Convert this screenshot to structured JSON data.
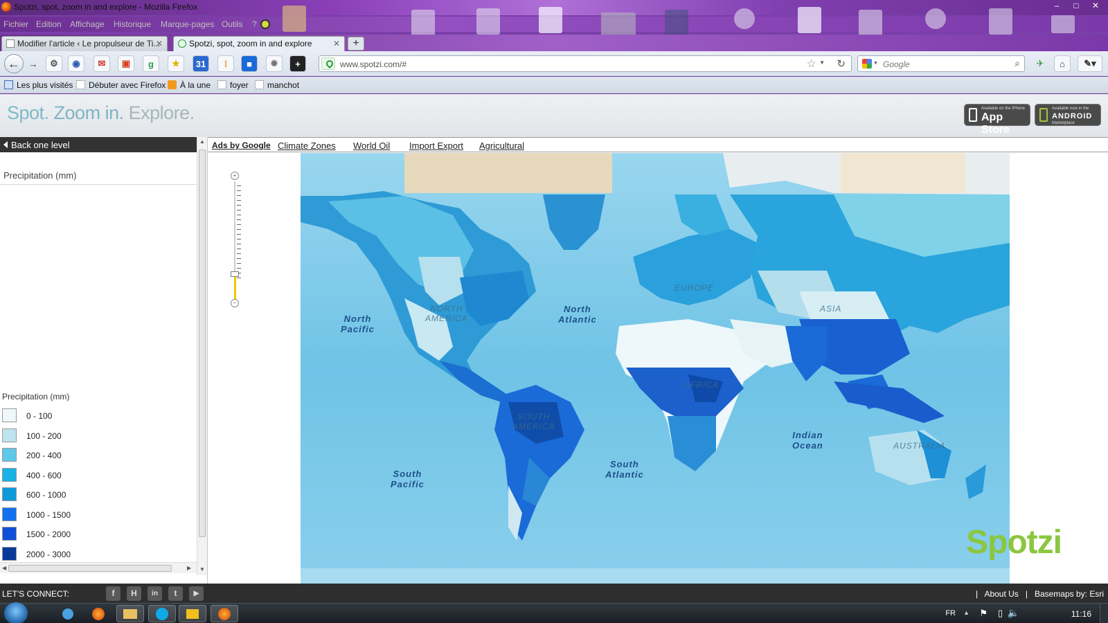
{
  "window": {
    "title": "Spotzi, spot, zoom in and explore - Mozilla Firefox",
    "controls": [
      "–",
      "□",
      "✕"
    ]
  },
  "menu": [
    "Fichier",
    "Edition",
    "Affichage",
    "Historique",
    "Marque-pages",
    "Outils",
    "?"
  ],
  "tabs": [
    {
      "label": "Modifier l'article ‹ Le propulseur de Ti...",
      "active": false
    },
    {
      "label": "Spotzi, spot, zoom in and explore",
      "active": true
    }
  ],
  "nav": {
    "url": "www.spotzi.com/#",
    "search_placeholder": "Google",
    "calendar_day": "31"
  },
  "bookmarks": [
    "Les plus visités",
    "Débuter avec Firefox",
    "À la une",
    "foyer",
    "manchot"
  ],
  "site": {
    "tagline": {
      "part1": "Spot.",
      "part2": " Zoom in.",
      "part3": " Explore."
    },
    "appstore": {
      "small": "Available on the iPhone",
      "big": "App Store"
    },
    "android": {
      "small": "Available now in the",
      "big": "ANDROID",
      "sub": "Marketplace"
    }
  },
  "panel": {
    "back_label": "Back one level",
    "title": "Precipitation (mm)",
    "legend_title": "Precipitation (mm)",
    "legend": [
      {
        "label": "0 - 100",
        "color": "#eef7fa"
      },
      {
        "label": "100 - 200",
        "color": "#bfe4f0"
      },
      {
        "label": "200 - 400",
        "color": "#5ec8e8"
      },
      {
        "label": "400 - 600",
        "color": "#18b2e6"
      },
      {
        "label": "600 - 1000",
        "color": "#0e9ad8"
      },
      {
        "label": "1000 - 1500",
        "color": "#1570f0"
      },
      {
        "label": "1500 - 2000",
        "color": "#1050d8"
      },
      {
        "label": "2000 - 3000",
        "color": "#0a3a98"
      }
    ]
  },
  "toplinks": [
    "Ads by Google",
    "Climate Zones",
    "World Oil",
    "Import Export",
    "Agricultural"
  ],
  "map": {
    "ocean_labels": [
      {
        "text": "North\nPacific"
      },
      {
        "text": "North\nAtlantic"
      },
      {
        "text": "South\nPacific"
      },
      {
        "text": "South\nAtlantic"
      },
      {
        "text": "Indian\nOcean"
      }
    ],
    "region_labels": [
      "NORTH\nAMERICA",
      "EUROPE",
      "AFRICA",
      "SOUTH\nAMERICA",
      "AUSTRALIA",
      "ASIA"
    ],
    "brand": "Spotzi"
  },
  "footer": {
    "connect": "LET'S CONNECT:",
    "social": [
      "f",
      "H",
      "in",
      "t",
      "▶"
    ],
    "about": "About Us",
    "basemaps": "Basemaps by: Esri",
    "separator": "|"
  },
  "taskbar": {
    "lang": "FR",
    "clock": "11:16"
  }
}
